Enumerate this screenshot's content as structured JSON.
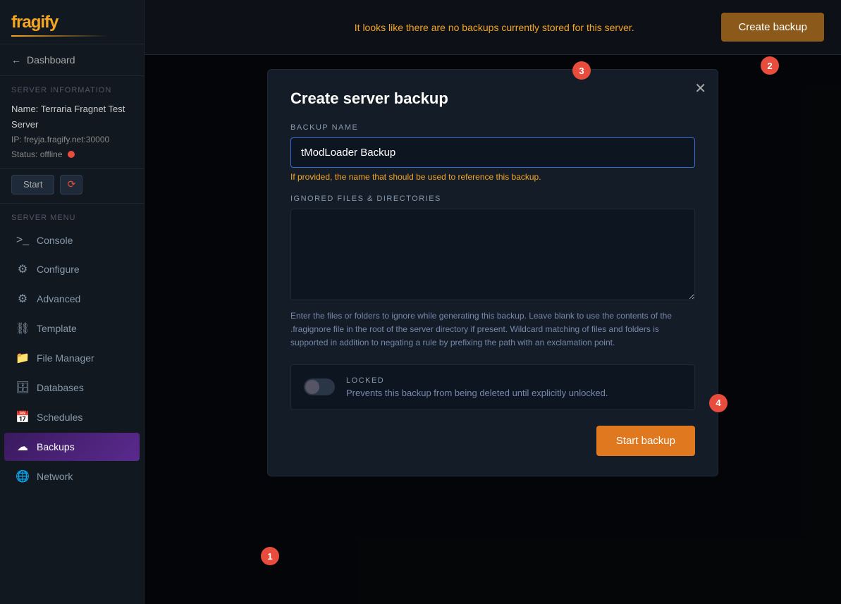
{
  "logo": {
    "prefix": "fra",
    "suffix": "ify"
  },
  "sidebar": {
    "back_label": "Dashboard",
    "server_info_label": "Server Information",
    "server_name_label": "Name:",
    "server_name": "Terraria Fragnet Test Server",
    "server_ip_label": "IP:",
    "server_ip": "freyja.fragify.net:30000",
    "server_status_label": "Status:",
    "server_status": "offline",
    "start_btn": "Start",
    "server_menu_label": "Server Menu",
    "nav_items": [
      {
        "id": "console",
        "label": "Console",
        "icon": ">_"
      },
      {
        "id": "configure",
        "label": "Configure",
        "icon": "⚙"
      },
      {
        "id": "advanced",
        "label": "Advanced",
        "icon": "⚙"
      },
      {
        "id": "template",
        "label": "Template",
        "icon": "🔗"
      },
      {
        "id": "file-manager",
        "label": "File Manager",
        "icon": "📁"
      },
      {
        "id": "databases",
        "label": "Databases",
        "icon": "🗄"
      },
      {
        "id": "schedules",
        "label": "Schedules",
        "icon": "📅"
      },
      {
        "id": "backups",
        "label": "Backups",
        "icon": "☁"
      },
      {
        "id": "network",
        "label": "Network",
        "icon": "🌐"
      }
    ]
  },
  "topbar": {
    "message": "It looks like there are no backups currently stored for this server.",
    "create_backup_btn": "Create backup"
  },
  "modal": {
    "title": "Create server backup",
    "backup_name_label": "BACKUP NAME",
    "backup_name_value": "tModLoader Backup",
    "backup_name_hint": "If provided, the name that should be used to reference this backup.",
    "ignored_files_label": "IGNORED FILES & DIRECTORIES",
    "ignored_files_value": "",
    "ignored_files_hint": "Enter the files or folders to ignore while generating this backup. Leave blank to use the contents of the .fragignore file in the root of the server directory if present. Wildcard matching of files and folders is supported in addition to negating a rule by prefixing the path with an exclamation point.",
    "locked_label": "LOCKED",
    "locked_desc": "Prevents this backup from being deleted until explicitly unlocked.",
    "start_backup_btn": "Start backup"
  },
  "steps": {
    "step1": "1",
    "step2": "2",
    "step3": "3",
    "step4": "4"
  }
}
